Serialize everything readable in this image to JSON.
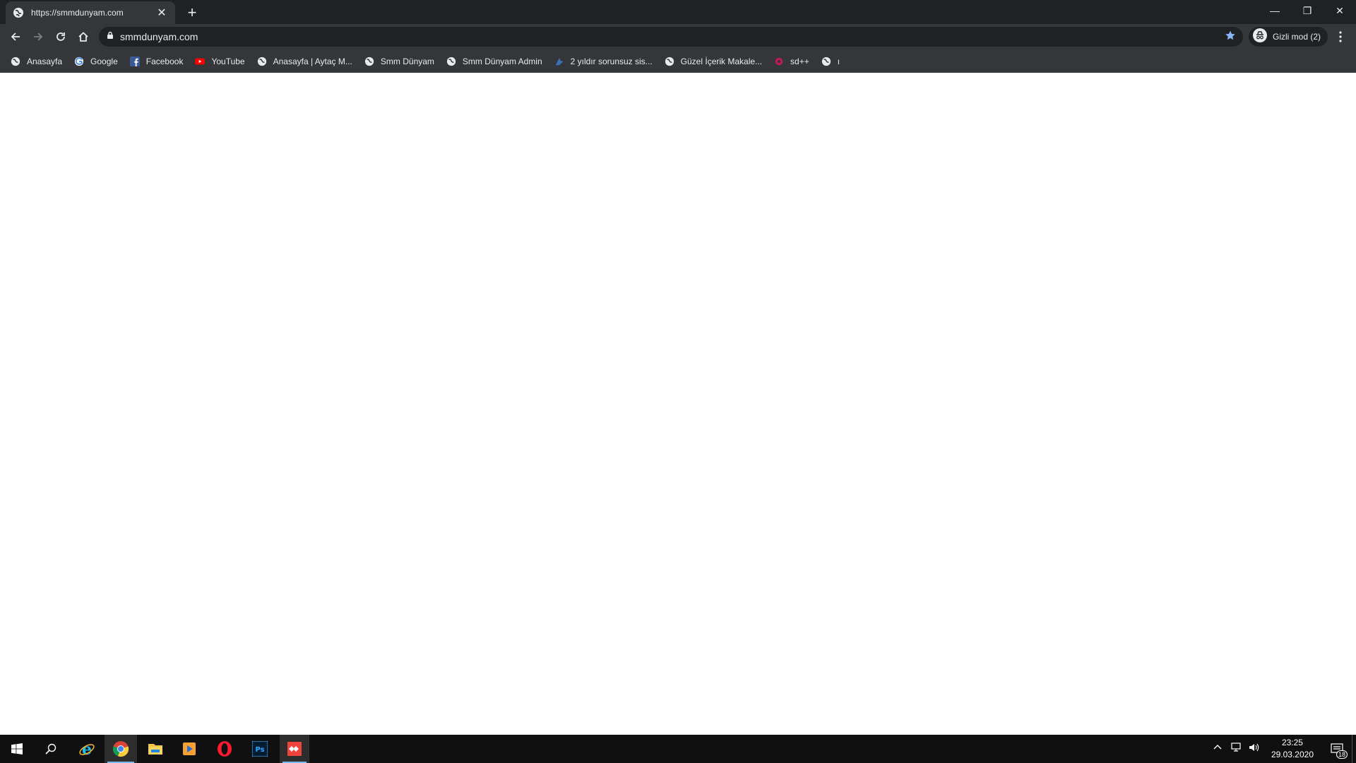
{
  "browser": {
    "tab": {
      "title": "https://smmdunyam.com",
      "favicon": "globe-icon"
    },
    "omnibox": {
      "url": "smmdunyam.com",
      "lock_icon": "lock-icon",
      "star_icon": "star-icon"
    },
    "profile": {
      "label": "Gizli mod (2)",
      "icon": "incognito-icon"
    },
    "bookmarks": [
      {
        "label": "Anasayfa",
        "icon": "globe-icon"
      },
      {
        "label": "Google",
        "icon": "google-icon"
      },
      {
        "label": "Facebook",
        "icon": "facebook-icon"
      },
      {
        "label": "YouTube",
        "icon": "youtube-icon"
      },
      {
        "label": "Anasayfa | Aytaç M...",
        "icon": "globe-icon"
      },
      {
        "label": "Smm Dünyam",
        "icon": "globe-icon"
      },
      {
        "label": "Smm Dünyam Admin",
        "icon": "globe-icon"
      },
      {
        "label": "2 yıldır sorunsuz sis...",
        "icon": "site-icon"
      },
      {
        "label": "Güzel İçerik Makale...",
        "icon": "globe-icon"
      },
      {
        "label": "sd++",
        "icon": "site-icon"
      },
      {
        "label": "ı",
        "icon": "globe-icon"
      }
    ]
  },
  "taskbar": {
    "apps": [
      "windows-start",
      "search",
      "internet-explorer",
      "chrome",
      "file-explorer",
      "media-player",
      "opera",
      "photoshop",
      "anydesk"
    ],
    "clock": {
      "time": "23:25",
      "date": "29.03.2020"
    },
    "notifications": "18"
  },
  "colors": {
    "chrome_dark": "#202124",
    "chrome_mid": "#35363a",
    "accent": "#8ab4f8",
    "taskbar": "#101010"
  }
}
